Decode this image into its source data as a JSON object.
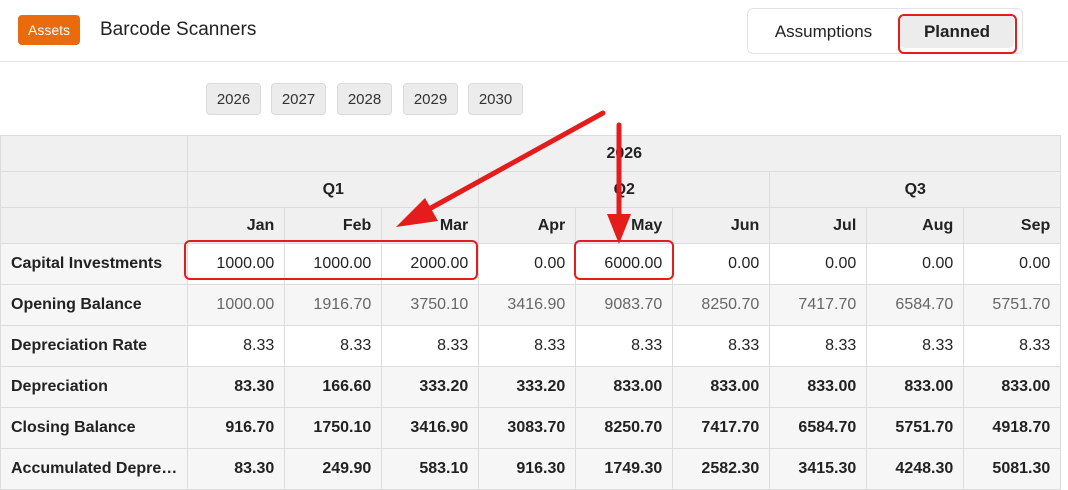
{
  "header": {
    "badge": "Assets",
    "title": "Barcode Scanners",
    "toggle": {
      "assumptions": "Assumptions",
      "planned": "Planned"
    }
  },
  "years": [
    "2026",
    "2027",
    "2028",
    "2029",
    "2030"
  ],
  "table": {
    "year": "2026",
    "quarters": [
      "Q1",
      "Q2",
      "Q3"
    ],
    "months": [
      "Jan",
      "Feb",
      "Mar",
      "Apr",
      "May",
      "Jun",
      "Jul",
      "Aug",
      "Sep"
    ],
    "rows": [
      {
        "label": "Capital Investments",
        "values": [
          "1000.00",
          "1000.00",
          "2000.00",
          "0.00",
          "6000.00",
          "0.00",
          "0.00",
          "0.00",
          "0.00"
        ]
      },
      {
        "label": "Opening Balance",
        "values": [
          "1000.00",
          "1916.70",
          "3750.10",
          "3416.90",
          "9083.70",
          "8250.70",
          "7417.70",
          "6584.70",
          "5751.70"
        ]
      },
      {
        "label": "Depreciation Rate",
        "values": [
          "8.33",
          "8.33",
          "8.33",
          "8.33",
          "8.33",
          "8.33",
          "8.33",
          "8.33",
          "8.33"
        ]
      },
      {
        "label": "Depreciation",
        "values": [
          "83.30",
          "166.60",
          "333.20",
          "333.20",
          "833.00",
          "833.00",
          "833.00",
          "833.00",
          "833.00"
        ]
      },
      {
        "label": "Closing Balance",
        "values": [
          "916.70",
          "1750.10",
          "3416.90",
          "3083.70",
          "8250.70",
          "7417.70",
          "6584.70",
          "5751.70",
          "4918.70"
        ]
      },
      {
        "label": "Accumulated Depre…",
        "values": [
          "83.30",
          "249.90",
          "583.10",
          "916.30",
          "1749.30",
          "2582.30",
          "3415.30",
          "4248.30",
          "5081.30"
        ]
      }
    ]
  },
  "colors": {
    "accent": "#ea6b0e",
    "highlight": "#e41c1c"
  }
}
